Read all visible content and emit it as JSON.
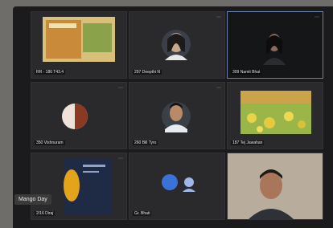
{
  "participants": [
    {
      "name": "RR - 186 T43.4"
    },
    {
      "name": "297 Deepthi N"
    },
    {
      "name": "309 Namit Bhat"
    },
    {
      "name": "350 Vishnuram"
    },
    {
      "name": "260 Bill Tyro"
    },
    {
      "name": "187 Tej Jawahan"
    },
    {
      "name": "2/16 Diraj"
    },
    {
      "name": "Gr. Bhati"
    },
    {
      "name": ""
    }
  ],
  "pip_label": "Mango Day",
  "colors": {
    "active_border": "#6a7ea8",
    "background": "#1b1b1d"
  }
}
